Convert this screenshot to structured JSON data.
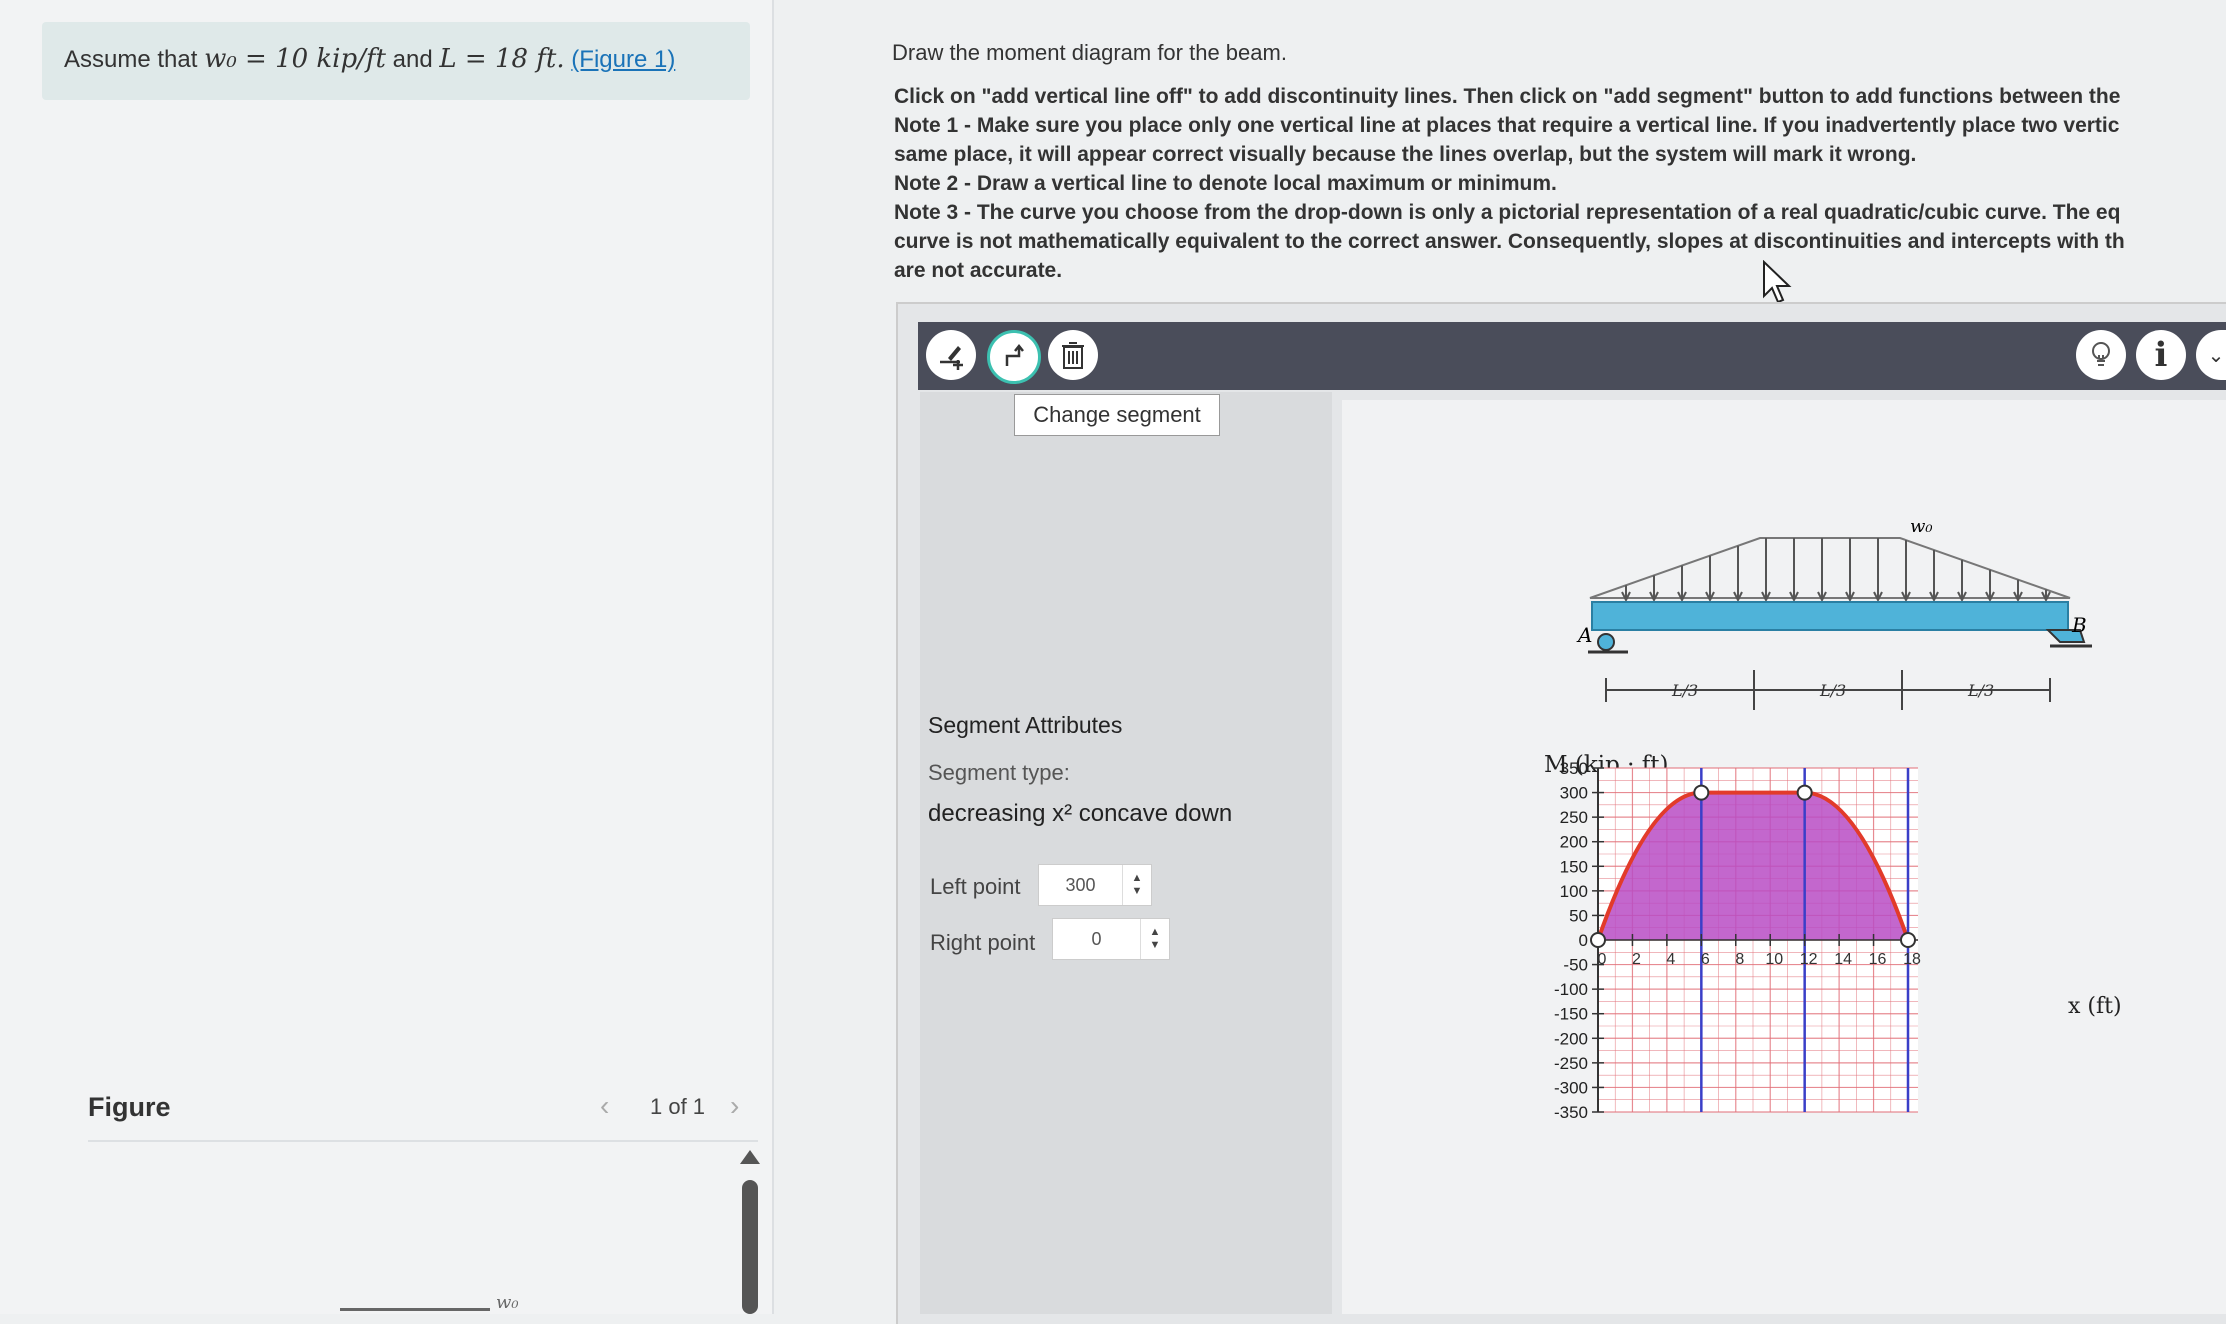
{
  "problem": {
    "prefix": "Assume that",
    "w0_expr": "w₀ = 10 kip/ft",
    "and": "and",
    "L_expr": "L = 18 ft.",
    "figure_link": "(Figure 1)"
  },
  "figure_pane": {
    "title": "Figure",
    "counter": "1 of 1",
    "prev_icon": "chevron-left-icon",
    "next_icon": "chevron-right-icon",
    "thumb_label": "w₀"
  },
  "instructions": {
    "title": "Draw the moment diagram for the beam.",
    "lines": [
      "Click on \"add vertical line off\" to add discontinuity lines. Then click on \"add segment\" button to add functions between the",
      "Note 1 - Make sure you place only one vertical line at places that require a vertical line. If you inadvertently place two vertic",
      "same place, it will appear correct visually because the lines overlap, but the system will mark it wrong.",
      "Note 2 - Draw a vertical line to denote local maximum or minimum.",
      "Note 3 - The curve you choose from the drop-down is only a pictorial representation of a real quadratic/cubic curve. The eq",
      "curve is not mathematically equivalent to the correct answer. Consequently, slopes at discontinuities and intercepts with th",
      "are not accurate."
    ]
  },
  "toolbar": {
    "buttons": [
      "add-vertical-line-icon",
      "change-segment-icon",
      "trash-icon"
    ],
    "right_buttons": [
      "lightbulb-icon",
      "info-icon",
      "chevron-down-icon"
    ],
    "tooltip": "Change segment"
  },
  "segment": {
    "title": "Segment Attributes",
    "type_label": "Segment type:",
    "type_value": "decreasing x² concave down",
    "left_label": "Left point",
    "left_value": "300",
    "right_label": "Right point",
    "right_value": "0"
  },
  "beam": {
    "load_label": "w₀",
    "left_support": "A",
    "right_support": "B",
    "span_labels": [
      "L/3",
      "L/3",
      "L/3"
    ]
  },
  "colors": {
    "fill": "#b84cc4",
    "curve": "#e23b2a",
    "grid": "#e26f78",
    "vline": "#3a3fc8",
    "beam": "#4fb3d9",
    "toolbar": "#4a4d5a"
  },
  "chart_data": {
    "type": "area",
    "title": "",
    "ylabel": "M (kip · ft)",
    "xlabel": "x (ft)",
    "ylim": [
      -350,
      350
    ],
    "xlim": [
      0,
      18
    ],
    "yticks": [
      350,
      300,
      250,
      200,
      150,
      100,
      50,
      0,
      -50,
      -100,
      -150,
      -200,
      -250,
      -300,
      -350
    ],
    "xticks": [
      0,
      2,
      4,
      6,
      8,
      10,
      12,
      14,
      16,
      18
    ],
    "vertical_lines": [
      6,
      12,
      18
    ],
    "segments": [
      {
        "x": [
          0,
          6
        ],
        "y": [
          0,
          300
        ],
        "shape": "increasing x² concave down"
      },
      {
        "x": [
          6,
          12
        ],
        "y": [
          300,
          300
        ],
        "shape": "constant"
      },
      {
        "x": [
          12,
          18
        ],
        "y": [
          300,
          0
        ],
        "shape": "decreasing x² concave down"
      }
    ],
    "points": [
      {
        "x": 0,
        "y": 0
      },
      {
        "x": 6,
        "y": 300
      },
      {
        "x": 12,
        "y": 300
      },
      {
        "x": 18,
        "y": 0
      }
    ]
  }
}
